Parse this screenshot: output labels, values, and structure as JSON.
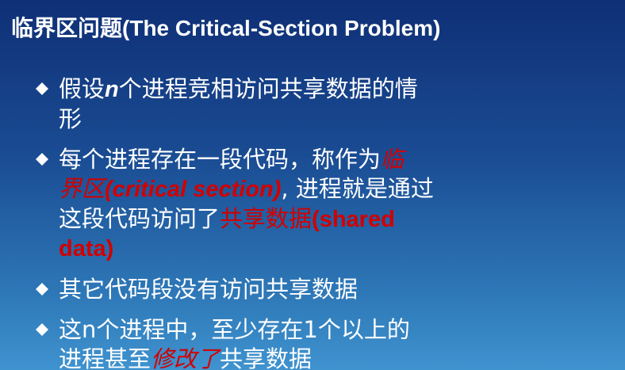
{
  "slide": {
    "title": {
      "zh": "临界区问题",
      "en": "(The Critical-Section Problem)"
    },
    "bullets": [
      {
        "line1_before": "假设",
        "line1_var": "n",
        "line1_after": "个进程竞相访问共享数据的情",
        "line2": "形"
      },
      {
        "line1_main": "每个进程存在一段代码，称作为",
        "line1_highlight": "临",
        "line2_highlight_zh": "界区",
        "line2_highlight_en": "(critical section)",
        "line2_after": ", 进程就是通过",
        "line3_main": "这段代码访问了",
        "line3_highlight_zh": "共享数据",
        "line3_highlight_en": "(shared",
        "line4_highlight": "data)"
      },
      {
        "text": "其它代码段没有访问共享数据"
      },
      {
        "line1": "这n个进程中，至少存在1个以上的",
        "line2_before": "进程甚至",
        "line2_highlight": "修改了",
        "line2_after": "共享数据"
      }
    ]
  }
}
